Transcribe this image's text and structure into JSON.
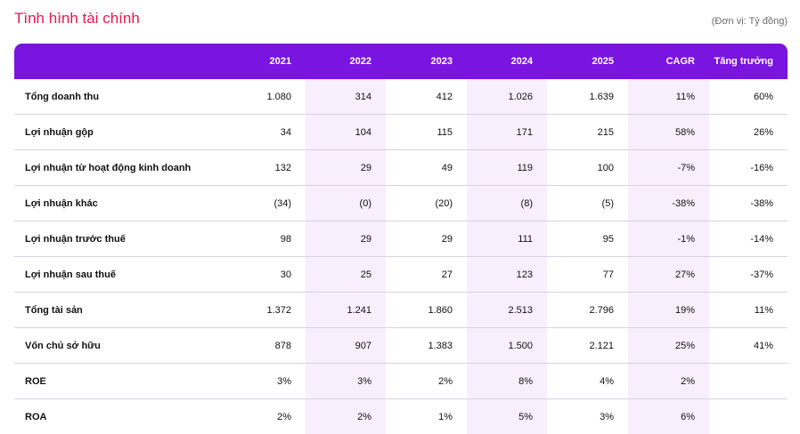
{
  "title": "Tình hình tài chính",
  "unit_note": "(Đơn vị: Tỷ đồng)",
  "columns": [
    "",
    "2021",
    "2022",
    "2023",
    "2024",
    "2025",
    "CAGR",
    "Tăng trưởng"
  ],
  "rows": [
    {
      "label": "Tổng doanh thu",
      "values": [
        "1.080",
        "314",
        "412",
        "1.026",
        "1.639",
        "11%",
        "60%"
      ]
    },
    {
      "label": "Lợi nhuận gộp",
      "values": [
        "34",
        "104",
        "115",
        "171",
        "215",
        "58%",
        "26%"
      ]
    },
    {
      "label": "Lợi nhuận từ hoạt động kinh doanh",
      "values": [
        "132",
        "29",
        "49",
        "119",
        "100",
        "-7%",
        "-16%"
      ]
    },
    {
      "label": "Lợi nhuận khác",
      "values": [
        "(34)",
        "(0)",
        "(20)",
        "(8)",
        "(5)",
        "-38%",
        "-38%"
      ]
    },
    {
      "label": "Lợi nhuận trước thuế",
      "values": [
        "98",
        "29",
        "29",
        "111",
        "95",
        "-1%",
        "-14%"
      ]
    },
    {
      "label": "Lợi nhuận sau thuế",
      "values": [
        "30",
        "25",
        "27",
        "123",
        "77",
        "27%",
        "-37%"
      ]
    },
    {
      "label": "Tổng tài sản",
      "values": [
        "1.372",
        "1.241",
        "1.860",
        "2.513",
        "2.796",
        "19%",
        "11%"
      ]
    },
    {
      "label": "Vốn chủ sở hữu",
      "values": [
        "878",
        "907",
        "1.383",
        "1.500",
        "2.121",
        "25%",
        "41%"
      ]
    },
    {
      "label": "ROE",
      "values": [
        "3%",
        "3%",
        "2%",
        "8%",
        "4%",
        "2%",
        ""
      ]
    },
    {
      "label": "ROA",
      "values": [
        "2%",
        "2%",
        "1%",
        "5%",
        "3%",
        "6%",
        ""
      ]
    }
  ],
  "colors": {
    "title": "#e8174f",
    "header_bg": "#7a14e0",
    "tint_column": "#f8eefc",
    "row_divider": "#d9d1e2"
  }
}
